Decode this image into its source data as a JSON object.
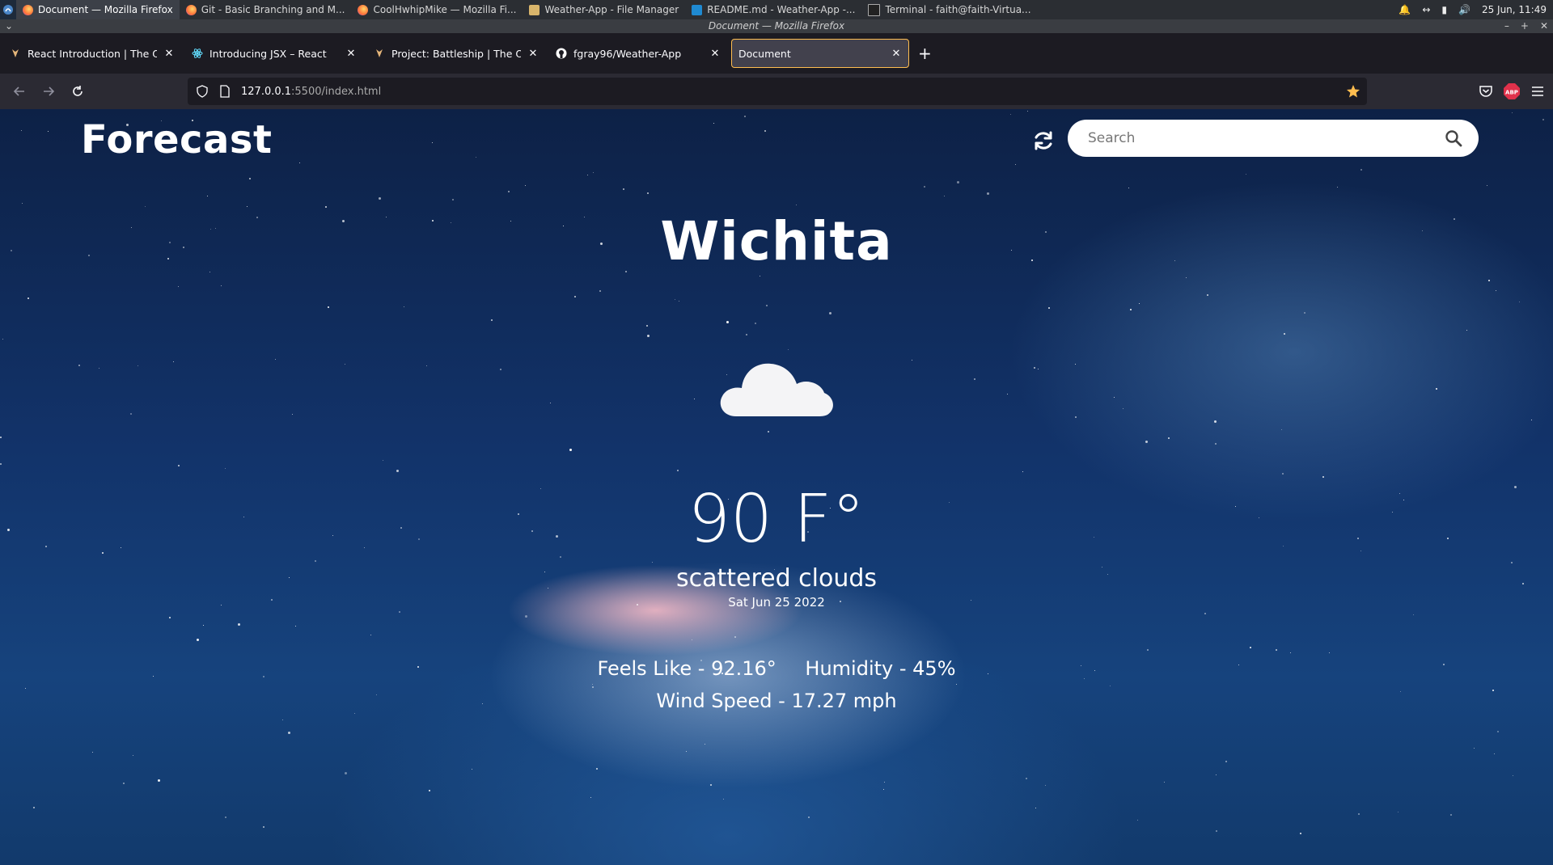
{
  "os": {
    "tasks": [
      {
        "label": "Document — Mozilla Firefox",
        "icon": "firefox-icon",
        "active": true
      },
      {
        "label": "Git - Basic Branching and M...",
        "icon": "firefox-icon"
      },
      {
        "label": "CoolHwhipMike — Mozilla Fi...",
        "icon": "firefox-icon"
      },
      {
        "label": "Weather-App - File Manager",
        "icon": "folder-icon"
      },
      {
        "label": "README.md - Weather-App -...",
        "icon": "vscode-icon"
      },
      {
        "label": "Terminal - faith@faith-Virtua...",
        "icon": "terminal-icon"
      }
    ],
    "clock": "25 Jun, 11:49"
  },
  "window": {
    "title": "Document — Mozilla Firefox"
  },
  "browser": {
    "tabs": [
      {
        "label": "React Introduction | The Odin",
        "icon": "odin-icon"
      },
      {
        "label": "Introducing JSX – React",
        "icon": "react-icon"
      },
      {
        "label": "Project: Battleship | The Odin",
        "icon": "odin-icon"
      },
      {
        "label": "fgray96/Weather-App",
        "icon": "github-icon"
      },
      {
        "label": "Document",
        "icon": "",
        "active": true
      }
    ],
    "url_host": "127.0.0.1",
    "url_path": ":5500/index.html"
  },
  "app": {
    "logo": "Forecast",
    "search_placeholder": "Search",
    "city": "Wichita",
    "weather_icon": "cloud-icon",
    "temperature": "90 F°",
    "description": "scattered clouds",
    "date": "Sat Jun 25 2022",
    "feels_like": "Feels Like - 92.16°",
    "humidity": "Humidity - 45%",
    "wind_speed": "Wind Speed - 17.27 mph"
  },
  "colors": {
    "accent_tab_border": "#ffbd4f",
    "bookmark_star": "#ffbd4f",
    "abp_badge": "#e0314b"
  }
}
